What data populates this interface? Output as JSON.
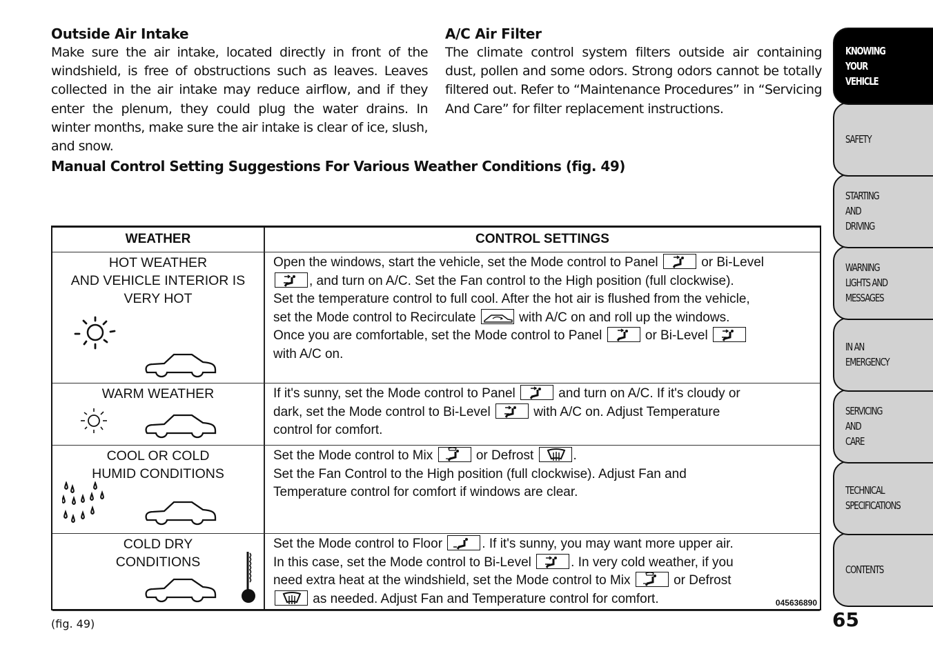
{
  "sections": {
    "outside_air": {
      "title": "Outside Air Intake",
      "body": "Make sure the air intake, located directly in front of the windshield, is free of obstructions such as leaves. Leaves collected in the air intake may reduce airflow, and if they enter the plenum, they could plug the water drains. In winter months, make sure the air intake is clear of ice, slush, and snow."
    },
    "ac_filter": {
      "title": "A/C Air Filter",
      "body": "The climate control system filters outside air containing dust, pollen and some odors. Strong odors cannot be totally filtered out. Refer to “Maintenance Procedures” in “Servicing And Care” for filter replacement instructions."
    }
  },
  "table_heading": "Manual Control Setting Suggestions For Various Weather Conditions (fig.  49)",
  "table": {
    "headers": {
      "weather": "WEATHER",
      "settings": "CONTROL SETTINGS"
    },
    "rows": [
      {
        "weather": "HOT WEATHER\nAND VEHICLE INTERIOR IS\nVERY HOT",
        "icons": [
          "sun-icon",
          "car-icon"
        ],
        "lines": [
          [
            "Open the windows, start the vehicle, set the Mode control to Panel",
            "{panel}",
            "or Bi-Level"
          ],
          [
            "{bilevel}",
            ", and turn on A/C. Set the Fan control to the High position (full clockwise)."
          ],
          [
            "Set the temperature control to full cool.  After the hot air is flushed from the vehicle,"
          ],
          [
            "set the Mode control to Recirculate",
            "{recirc}",
            "with A/C on and roll up the windows."
          ],
          [
            "Once you are comfortable, set the Mode control to Panel",
            "{panel}",
            "or Bi-Level",
            "{bilevel}"
          ],
          [
            "with A/C on."
          ]
        ]
      },
      {
        "weather": "WARM WEATHER",
        "icons": [
          "sun-icon",
          "car-icon"
        ],
        "lines": [
          [
            "If it's sunny, set the Mode control to Panel",
            "{panel}",
            "and turn on A/C. If it's cloudy or"
          ],
          [
            "dark, set the Mode control to Bi-Level",
            "{bilevel}",
            "with A/C on. Adjust Temperature"
          ],
          [
            "control for comfort."
          ]
        ]
      },
      {
        "weather": "COOL OR COLD\nHUMID CONDITIONS",
        "icons": [
          "raindrops-icon",
          "car-icon"
        ],
        "lines": [
          [
            "Set the Mode control to Mix",
            "{mix}",
            "or Defrost",
            "{defrost}",
            "."
          ],
          [
            "Set the Fan Control to the High position (full clockwise). Adjust Fan and"
          ],
          [
            "Temperature control for comfort if windows are clear."
          ]
        ]
      },
      {
        "weather": "COLD DRY\nCONDITIONS",
        "icons": [
          "car-icon",
          "thermometer-icon"
        ],
        "lines": [
          [
            "Set the Mode control to Floor",
            "{floor}",
            ". If it's sunny, you may want more upper air."
          ],
          [
            "In this case, set the Mode control to Bi-Level",
            "{bilevel}",
            ". In very cold weather, if you"
          ],
          [
            "need extra heat at the windshield, set the Mode control to Mix",
            "{mix}",
            "or Defrost"
          ],
          [
            "{defrost}",
            "as needed. Adjust Fan and Temperature control for comfort."
          ]
        ]
      }
    ],
    "figure_id": "045636890"
  },
  "fig_caption": "(fig. 49)",
  "tabs": [
    {
      "label": "KNOWING\nYOUR\nVEHICLE",
      "active": true
    },
    {
      "label": "SAFETY",
      "active": false
    },
    {
      "label": "STARTING\nAND\nDRIVING",
      "active": false
    },
    {
      "label": "WARNING\nLIGHTS AND\nMESSAGES",
      "active": false
    },
    {
      "label": "IN AN\nEMERGENCY",
      "active": false
    },
    {
      "label": "SERVICING\nAND\nCARE",
      "active": false
    },
    {
      "label": "TECHNICAL\nSPECIFICATIONS",
      "active": false
    },
    {
      "label": "CONTENTS",
      "active": false
    }
  ],
  "page_number": "65",
  "colors": {
    "tab_bg": "#d2d2d2",
    "tab_active_bg": "#000000",
    "text": "#111111"
  }
}
